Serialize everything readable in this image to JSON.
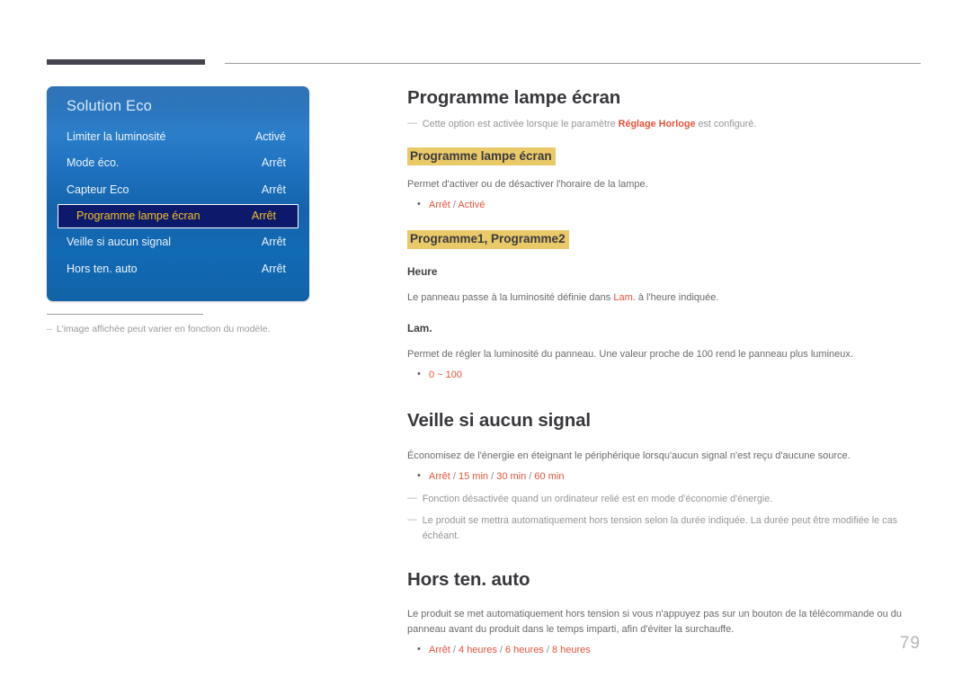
{
  "header": {
    "accent_color": "#46454f",
    "rule_color": "#9c9ba2"
  },
  "osd": {
    "title": "Solution Eco",
    "panel_color_top": "#2f73b8",
    "panel_color_bottom": "#1262a6",
    "selected_bg": "#0d1a6b",
    "selected_text_color": "#f2c029",
    "items": [
      {
        "label": "Limiter la luminosité",
        "value": "Activé",
        "selected": false
      },
      {
        "label": "Mode éco.",
        "value": "Arrêt",
        "selected": false
      },
      {
        "label": "Capteur Eco",
        "value": "Arrêt",
        "selected": false
      },
      {
        "label": "Programme lampe écran",
        "value": "Arrêt",
        "selected": true
      },
      {
        "label": "Veille si aucun signal",
        "value": "Arrêt",
        "selected": false
      },
      {
        "label": "Hors ten. auto",
        "value": "Arrêt",
        "selected": false
      }
    ],
    "footnote_dash": "–",
    "footnote": "L'image affichée peut varier en fonction du modèle."
  },
  "content": {
    "highlight_color": "#e9c968",
    "accent_color": "#e2543a",
    "section1": {
      "title": "Programme lampe écran",
      "note_dash": "—",
      "note_prefix": "Cette option est activée lorsque le paramètre ",
      "note_bold": "Réglage Horloge",
      "note_suffix": " est configuré.",
      "sub1_title": "Programme lampe écran",
      "sub1_body": "Permet d'activer ou de désactiver l'horaire de la lampe.",
      "sub1_options": [
        "Arrêt",
        "Activé"
      ],
      "sub2_title": "Programme1, Programme2",
      "sub2a_title": "Heure",
      "sub2a_body_pre": "Le panneau passe à la luminosité définie dans ",
      "sub2a_body_hot": "Lam.",
      "sub2a_body_post": " à l'heure indiquée.",
      "sub2b_title": "Lam.",
      "sub2b_body": "Permet de régler la luminosité du panneau. Une valeur proche de 100 rend le panneau plus lumineux.",
      "sub2b_options": [
        "0 ~ 100"
      ]
    },
    "section2": {
      "title": "Veille si aucun signal",
      "body": "Économisez de l'énergie en éteignant le périphérique lorsqu'aucun signal n'est reçu d'aucune source.",
      "options": [
        "Arrêt",
        "15 min",
        "30 min",
        "60 min"
      ],
      "note_dash": "—",
      "note1": "Fonction désactivée quand un ordinateur relié est en mode d'économie d'énergie.",
      "note2": "Le produit se mettra automatiquement hors tension selon la durée indiquée. La durée peut être modifiée le cas échéant."
    },
    "section3": {
      "title": "Hors ten. auto",
      "body": "Le produit se met automatiquement hors tension si vous n'appuyez pas sur un bouton de la télécommande ou du panneau avant du produit dans le temps imparti, afin d'éviter la surchauffe.",
      "options": [
        "Arrêt",
        "4 heures",
        "6 heures",
        "8 heures"
      ]
    }
  },
  "footer": {
    "page_number": "79"
  }
}
